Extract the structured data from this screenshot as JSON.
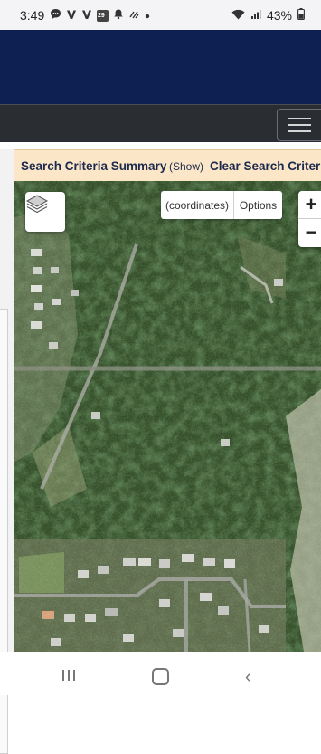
{
  "status_bar": {
    "time": "3:49",
    "notification_icons": [
      "message-icon",
      "v-app-icon",
      "v-app-icon",
      "calendar-icon",
      "bell-icon",
      "sync-icon",
      "dot-icon"
    ],
    "calendar_day": "29",
    "battery": "43%",
    "right_icons": [
      "wifi-icon",
      "signal-icon",
      "battery-icon"
    ]
  },
  "header": {
    "brand_color": "#0e1f52"
  },
  "navbar": {
    "menu_icon": "hamburger-icon"
  },
  "criteria_bar": {
    "title": "Search Criteria Summary",
    "show_link": "(Show)",
    "clear_link": "Clear Search Criteria"
  },
  "map": {
    "layers_icon": "layers-icon",
    "coordinates_label": "(coordinates)",
    "options_label": "Options",
    "zoom_in": "+",
    "zoom_out": "−"
  },
  "android_nav": {
    "recent_icon": "recent-apps-icon",
    "home_icon": "home-icon",
    "back_icon": "back-icon",
    "back_glyph": "‹"
  }
}
